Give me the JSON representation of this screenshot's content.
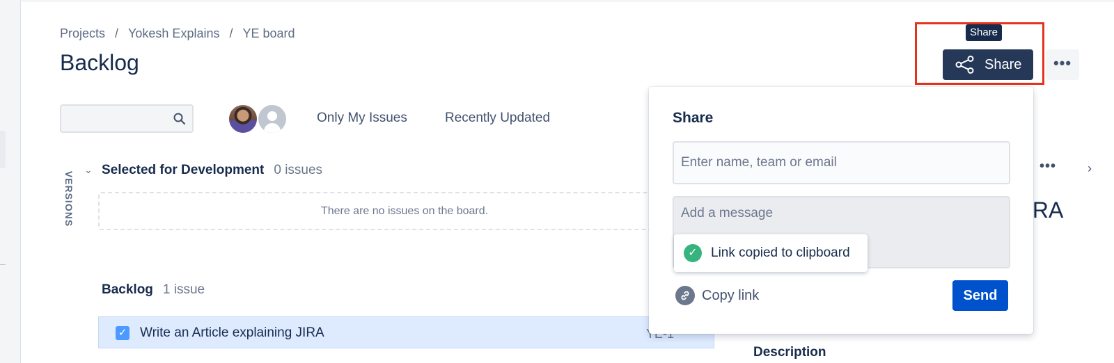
{
  "breadcrumb": {
    "items": [
      "Projects",
      "Yokesh Explains",
      "YE board"
    ],
    "separator": "/"
  },
  "page": {
    "title": "Backlog"
  },
  "search": {
    "placeholder": ""
  },
  "filters": {
    "only_my_issues": "Only My Issues",
    "recently_updated": "Recently Updated"
  },
  "sidebar_tab": {
    "versions": "VERSIONS"
  },
  "sprint": {
    "name": "Selected for Development",
    "count": "0 issues",
    "empty_text": "There are no issues on the board."
  },
  "backlog": {
    "name": "Backlog",
    "count": "1 issue",
    "issues": [
      {
        "summary": "Write an Article explaining JIRA",
        "key": "YE-1"
      }
    ]
  },
  "toolbar": {
    "tooltip": "Share",
    "share_label": "Share",
    "more_label": "•••"
  },
  "detail": {
    "more_label": "•••",
    "title_fragment": "IRA",
    "description_label": "Description"
  },
  "share_dialog": {
    "heading": "Share",
    "recipients_placeholder": "Enter name, team or email",
    "message_placeholder": "Add a message",
    "toast_text": "Link copied to clipboard",
    "copy_link_label": "Copy link",
    "send_label": "Send"
  },
  "colors": {
    "primary": "#0052cc",
    "share_button": "#253858",
    "highlight": "#e5321e",
    "success": "#36b37e",
    "selected_row": "#deebff"
  }
}
